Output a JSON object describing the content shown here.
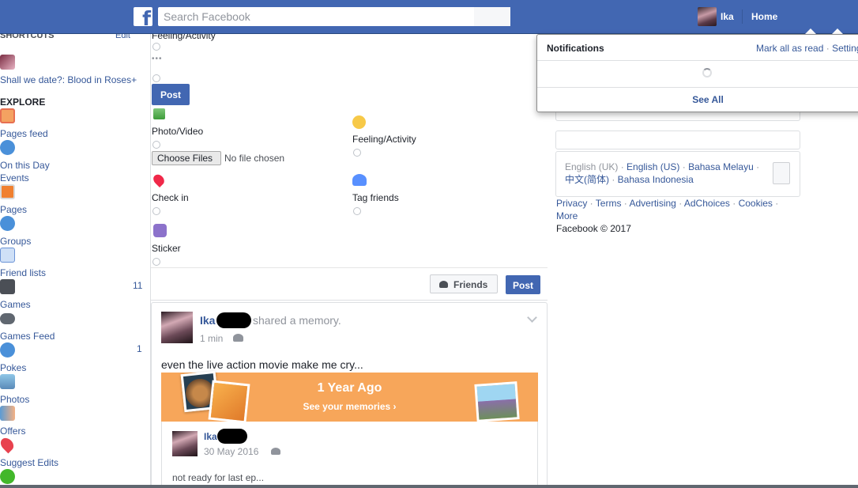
{
  "topbar": {
    "logo_glyph": "f",
    "search_placeholder": "Search Facebook",
    "user_name": "Ika",
    "home_label": "Home",
    "brand_color": "#4267b2"
  },
  "left_nav": {
    "shortcuts_heading": "SHORTCUTS",
    "shortcuts_edit": "Edit",
    "shortcut_item": "Shall we date?: Blood in Roses+",
    "explore_heading": "EXPLORE",
    "items": [
      {
        "label": "Pages feed",
        "icon": "pages-feed-icon"
      },
      {
        "label": "On this Day",
        "icon": "on-this-day-icon"
      },
      {
        "label": "Events",
        "icon": "events-icon"
      },
      {
        "label": "Pages",
        "icon": "pages-icon"
      },
      {
        "label": "Groups",
        "icon": "groups-icon"
      },
      {
        "label": "Friend lists",
        "icon": "friend-lists-icon"
      },
      {
        "label": "Games",
        "icon": "games-icon",
        "count": "11"
      },
      {
        "label": "Games Feed",
        "icon": "games-feed-icon"
      },
      {
        "label": "Pokes",
        "icon": "pokes-icon",
        "count": "1"
      },
      {
        "label": "Photos",
        "icon": "photos-icon"
      },
      {
        "label": "Offers",
        "icon": "offers-icon"
      },
      {
        "label": "Suggest Edits",
        "icon": "suggest-edits-icon"
      }
    ]
  },
  "composer": {
    "top_option": "Feeling/Activity",
    "more_dots": "•••",
    "post_label": "Post",
    "options": [
      {
        "label": "Photo/Video",
        "icon": "photo-video-icon"
      },
      {
        "label": "Feeling/Activity",
        "icon": "feeling-icon"
      },
      {
        "label": "Check in",
        "icon": "check-in-icon"
      },
      {
        "label": "Tag friends",
        "icon": "tag-friends-icon"
      },
      {
        "label": "Sticker",
        "icon": "sticker-icon"
      }
    ],
    "choose_files": "Choose Files",
    "no_file": "No file chosen",
    "audience_label": "Friends",
    "submit_label": "Post"
  },
  "feed_post": {
    "author": "Ika",
    "action": "shared a memory.",
    "time": "1 min",
    "text": "even the live action movie make me cry...",
    "memory_title": "1 Year Ago",
    "memory_sub": "See your memories ›",
    "memory_color": "#f7a65a",
    "inner_author": "Ika",
    "inner_date": "30 May 2016",
    "inner_text": "not ready for last ep..."
  },
  "notifications": {
    "title": "Notifications",
    "mark_all": "Mark all as read",
    "separator": "·",
    "settings": "Settings",
    "see_all": "See All"
  },
  "right_col": {
    "languages_current": "English (UK)",
    "lang_links": [
      "English (US)",
      "Bahasa Melayu",
      "中文(简体)",
      "Bahasa Indonesia"
    ],
    "footer_links": [
      "Privacy",
      "Terms",
      "Advertising",
      "AdChoices",
      "Cookies",
      "More"
    ],
    "copyright": "Facebook © 2017"
  }
}
